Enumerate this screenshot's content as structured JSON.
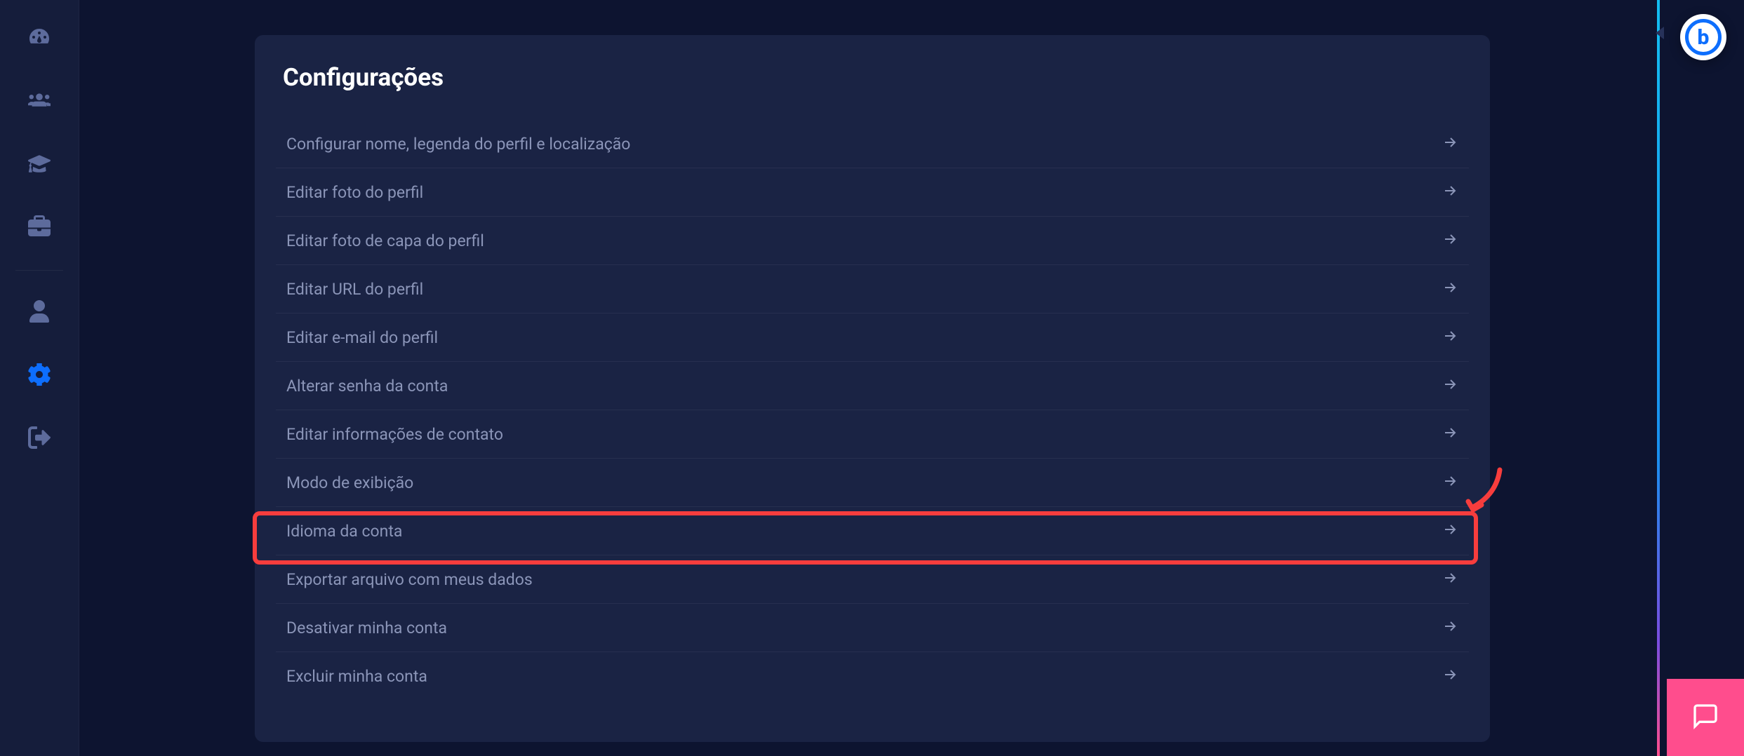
{
  "sidebar": {
    "items": [
      {
        "name": "dashboard",
        "icon": "dashboard-icon",
        "active": false
      },
      {
        "name": "users",
        "icon": "users-icon",
        "active": false
      },
      {
        "name": "education",
        "icon": "graduation-icon",
        "active": false
      },
      {
        "name": "work",
        "icon": "briefcase-icon",
        "active": false
      },
      {
        "name": "profile",
        "icon": "person-icon",
        "active": false
      },
      {
        "name": "settings",
        "icon": "gear-icon",
        "active": true
      },
      {
        "name": "logout",
        "icon": "logout-icon",
        "active": false
      }
    ]
  },
  "card": {
    "title": "Configurações",
    "rows": [
      {
        "label": "Configurar nome, legenda do perfil e localização",
        "highlighted": false
      },
      {
        "label": "Editar foto do perfil",
        "highlighted": false
      },
      {
        "label": "Editar foto de capa do perfil",
        "highlighted": false
      },
      {
        "label": "Editar URL do perfil",
        "highlighted": false
      },
      {
        "label": "Editar e-mail do perfil",
        "highlighted": false
      },
      {
        "label": "Alterar senha da conta",
        "highlighted": false
      },
      {
        "label": "Editar informações de contato",
        "highlighted": false
      },
      {
        "label": "Modo de exibição",
        "highlighted": false
      },
      {
        "label": "Idioma da conta",
        "highlighted": true
      },
      {
        "label": "Exportar arquivo com meus dados",
        "highlighted": false
      },
      {
        "label": "Desativar minha conta",
        "highlighted": false
      },
      {
        "label": "Excluir minha conta",
        "highlighted": false
      }
    ]
  },
  "badge": {
    "letter": "b"
  },
  "colors": {
    "accent": "#0d6efd",
    "highlight": "#f73d3d",
    "chat_bg": "#ff4d8d"
  }
}
